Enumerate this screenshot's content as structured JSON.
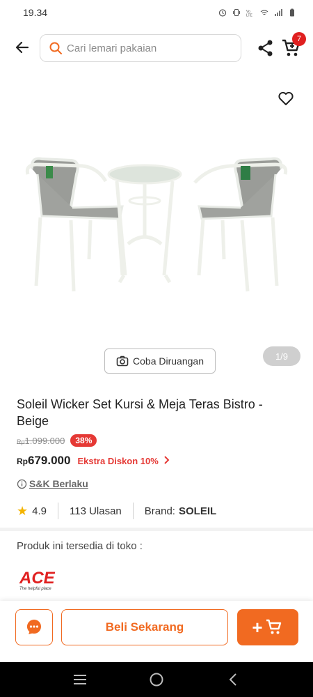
{
  "status_bar": {
    "time": "19.34",
    "icons": [
      "alarm-icon",
      "vibrate-icon",
      "volte-icon",
      "wifi-icon",
      "signal-icon",
      "battery-icon"
    ]
  },
  "header": {
    "search_placeholder": "Cari lemari pakaian",
    "cart_count": "7"
  },
  "gallery": {
    "try_in_room_label": "Coba Diruangan",
    "pager": "1/9"
  },
  "product": {
    "title": "Soleil Wicker Set Kursi & Meja Teras Bistro - Beige",
    "old_price_currency": "Rp",
    "old_price": "1.099.000",
    "discount_badge": "38%",
    "price_currency": "Rp",
    "price": "679.000",
    "extra_discount": "Ekstra Diskon 10%",
    "terms_label": "S&K Berlaku",
    "rating": "4.9",
    "reviews": "113 Ulasan",
    "brand_label": "Brand:",
    "brand": "SOLEIL"
  },
  "store": {
    "available_label": "Produk ini tersedia di toko :",
    "store_logo": "ACE",
    "store_tagline": "The helpful place"
  },
  "actions": {
    "buy_now": "Beli Sekarang"
  },
  "colors": {
    "accent": "#f16a21",
    "discount": "#e53935",
    "badge": "#e02020",
    "star": "#f4b400"
  }
}
